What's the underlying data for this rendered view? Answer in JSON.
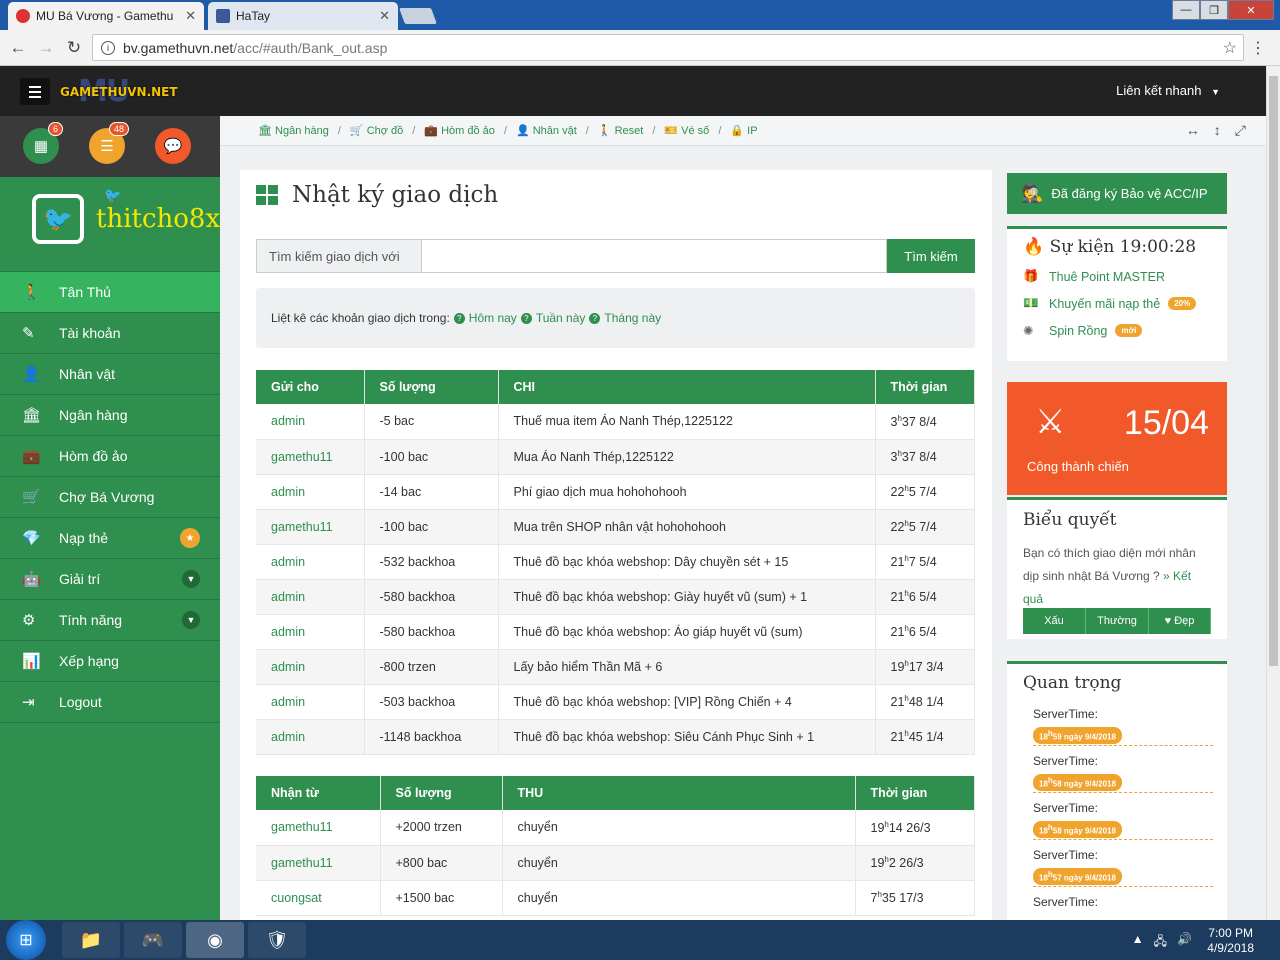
{
  "browser": {
    "tabs": [
      {
        "title": "MU Bá Vương - Gamethu",
        "close": "✕"
      },
      {
        "title": "HaTay",
        "close": "✕"
      }
    ],
    "url_host": "bv.gamethuvn.net",
    "url_path": "/acc/#auth/Bank_out.asp"
  },
  "header": {
    "logo_mu": "MU",
    "logo_text": "GAMETHUVN.NET",
    "quick_links": "Liên kết nhanh"
  },
  "sidebar": {
    "counters": [
      {
        "badge": "6"
      },
      {
        "badge": "48"
      }
    ],
    "username": "thitcho8x",
    "items": [
      {
        "label": "Tân Thủ"
      },
      {
        "label": "Tài khoản"
      },
      {
        "label": "Nhân vật"
      },
      {
        "label": "Ngân hàng"
      },
      {
        "label": "Hòm đồ ảo"
      },
      {
        "label": "Chợ Bá Vương"
      },
      {
        "label": "Nạp thẻ"
      },
      {
        "label": "Giải trí"
      },
      {
        "label": "Tính năng"
      },
      {
        "label": "Xếp hạng"
      },
      {
        "label": "Logout"
      }
    ]
  },
  "breadcrumb": [
    "Ngân hàng",
    "Chợ đồ",
    "Hòm đồ ảo",
    "Nhân vật",
    "Reset",
    "Vé số",
    "IP"
  ],
  "main": {
    "title": "Nhật ký giao dịch",
    "search_label": "Tìm kiếm giao dịch với",
    "search_button": "Tìm kiếm",
    "filter_text": "Liệt kê các khoản giao dịch trong:",
    "filter_links": [
      "Hôm nay",
      "Tuần này",
      "Tháng này"
    ]
  },
  "out_table": {
    "headers": [
      "Gửi cho",
      "Số lượng",
      "CHI",
      "Thời gian"
    ],
    "rows": [
      {
        "to": "admin",
        "amount": "-5  bac",
        "desc": "Thuế mua item Áo Nanh Thép,1225122",
        "h": "3",
        "t": "37 8/4"
      },
      {
        "to": "gamethu11",
        "amount": "-100  bac",
        "desc": "Mua Áo Nanh Thép,1225122",
        "h": "3",
        "t": "37 8/4"
      },
      {
        "to": "admin",
        "amount": "-14  bac",
        "desc": "Phí giao dịch mua hohohohooh",
        "h": "22",
        "t": "5 7/4"
      },
      {
        "to": "gamethu11",
        "amount": "-100  bac",
        "desc": "Mua trên SHOP nhân vật hohohohooh",
        "h": "22",
        "t": "5 7/4"
      },
      {
        "to": "admin",
        "amount": "-532  backhoa",
        "desc": "Thuê đồ bạc khóa webshop: Dây chuyền sét + 15",
        "h": "21",
        "t": "7 5/4"
      },
      {
        "to": "admin",
        "amount": "-580  backhoa",
        "desc": "Thuê đồ bạc khóa webshop: Giày huyết vũ (sum) + 1",
        "h": "21",
        "t": "6 5/4"
      },
      {
        "to": "admin",
        "amount": "-580  backhoa",
        "desc": "Thuê đồ bạc khóa webshop: Áo giáp huyết vũ (sum)",
        "h": "21",
        "t": "6 5/4"
      },
      {
        "to": "admin",
        "amount": "-800  trzen",
        "desc": "Lấy bảo hiểm Thần Mã + 6",
        "h": "19",
        "t": "17 3/4"
      },
      {
        "to": "admin",
        "amount": "-503  backhoa",
        "desc": "Thuê đồ bạc khóa webshop: [VIP] Rồng Chiến + 4",
        "h": "21",
        "t": "48 1/4"
      },
      {
        "to": "admin",
        "amount": "-1148  backhoa",
        "desc": "Thuê đồ bạc khóa webshop: Siêu Cánh Phục Sinh + 1",
        "h": "21",
        "t": "45 1/4"
      }
    ]
  },
  "in_table": {
    "headers": [
      "Nhận từ",
      "Số lượng",
      "THU",
      "Thời gian"
    ],
    "rows": [
      {
        "from": "gamethu11",
        "amount": "+2000  trzen",
        "desc": "chuyển",
        "h": "19",
        "t": "14 26/3"
      },
      {
        "from": "gamethu11",
        "amount": "+800  bac",
        "desc": "chuyển",
        "h": "19",
        "t": "2 26/3"
      },
      {
        "from": "cuongsat",
        "amount": "+1500  bac",
        "desc": "chuyển",
        "h": "7",
        "t": "35 17/3"
      }
    ]
  },
  "right": {
    "protect": "Đã đăng ký Bảo vệ ACC/IP",
    "event_title": "Sự kiện 19:00:28",
    "events": [
      {
        "label": "Thuê Point MASTER",
        "tag": ""
      },
      {
        "label": "Khuyến mãi nạp thẻ",
        "tag": "20%"
      },
      {
        "label": "Spin Rồng",
        "tag": "mới"
      }
    ],
    "castle_date": "15/04",
    "castle_label": "Công thành chiến",
    "poll_title": "Biểu quyết",
    "poll_text": "Bạn có thích giao diện mới nhân dịp sinh nhật Bá Vương ?",
    "poll_link": "» Kết quả",
    "votes": [
      "Xấu",
      "Thường",
      "♥ Đẹp"
    ],
    "important_title": "Quan trọng",
    "server_label": "ServerTime:",
    "servertimes": [
      {
        "h": "18",
        "rest": "59 ngày 9/4/2018"
      },
      {
        "h": "18",
        "rest": "58 ngày 9/4/2018"
      },
      {
        "h": "18",
        "rest": "58 ngày 9/4/2018"
      },
      {
        "h": "18",
        "rest": "57 ngày 9/4/2018"
      },
      {
        "h": "",
        "rest": ""
      }
    ]
  },
  "taskbar": {
    "time": "7:00 PM",
    "date": "4/9/2018"
  }
}
